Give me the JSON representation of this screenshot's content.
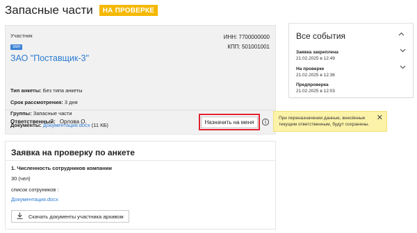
{
  "page": {
    "title": "Запасные части",
    "status_badge": "НА ПРОВЕРКЕ"
  },
  "participant_card": {
    "participant_label": "Участник",
    "smb_tag": "SMH",
    "company_name": "ЗАО \"Поставщик-3\"",
    "inn": "ИНН: 7700000000",
    "kpp": "КПП: 501001001",
    "questionnaire_type_label": "Тип анкеты:",
    "questionnaire_type_value": "Без типа анкеты",
    "review_period_label": "Срок рассмотрения:",
    "review_period_value": "3 дня",
    "groups_label": "Группы:",
    "groups_value": "Запасные части",
    "documents_label": "Документы:",
    "documents_link": "Документация.docx",
    "documents_size": "(11 КБ)",
    "responsible_label": "Ответственный:",
    "responsible_value": "Орлова О.",
    "assign_button": "Назначить на меня",
    "info_icon_glyph": "i"
  },
  "tooltip": {
    "text": "При переназначении данные, внесённые текущим ответственным, будут сохранены.",
    "close_glyph": "✕"
  },
  "events": {
    "title": "Все события",
    "items": [
      {
        "title": "Заявка закреплена",
        "date": "21.02.2025 в 12:49"
      },
      {
        "title": "На проверке",
        "date": "21.02.2025 в 12:36"
      },
      {
        "title": "Предпроверка",
        "date": "21.02.2025 в 12:03"
      }
    ]
  },
  "review": {
    "title": "Заявка на проверку по анкете",
    "question": "1. Численность сотрудников компании",
    "answer": "30 (чел)",
    "list_label": "список сотрунико­в :",
    "attachment_link": "Документация.docx",
    "download_button": "Скачать документы участника архивом"
  },
  "icons": {
    "chevron_up": "chevron-up-icon",
    "chevron_down": "chevron-down-icon",
    "info": "info-icon",
    "close": "close-icon",
    "download": "download-icon"
  },
  "colors": {
    "accent_link": "#2a7bd3",
    "badge": "#f5b800",
    "highlight_border": "#e0202e",
    "tooltip_bg": "#fdf3a8"
  }
}
